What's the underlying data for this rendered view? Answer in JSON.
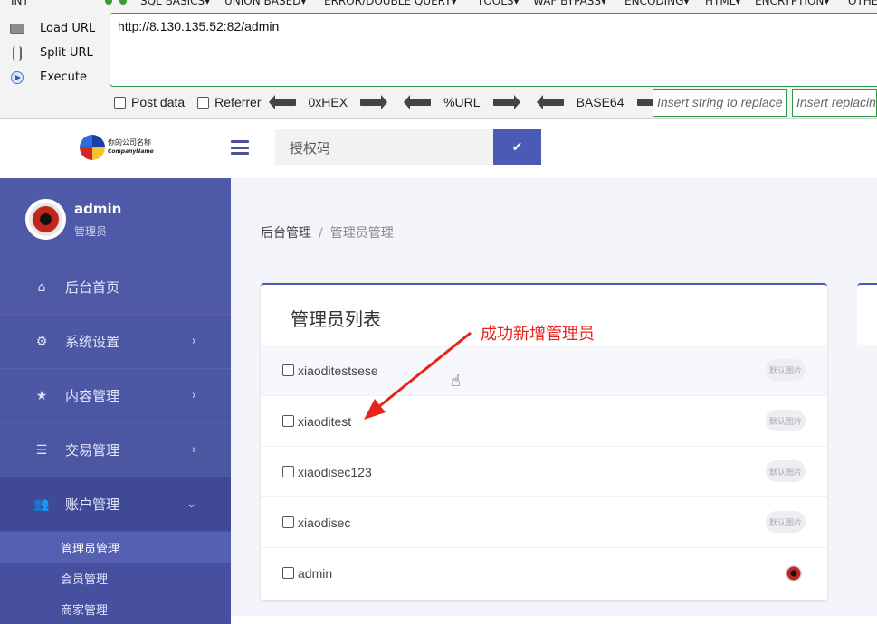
{
  "hackbar": {
    "menu": [
      "INT",
      "SQL BASICS▾",
      "UNION BASED▾",
      "ERROR/DOUBLE QUERY▾",
      "TOOLS▾",
      "WAF BYPASS▾",
      "ENCODING▾",
      "HTML▾",
      "ENCRYPTION▾",
      "OTHER"
    ],
    "actions": {
      "load": "Load URL",
      "split": "Split URL",
      "execute": "Execute"
    },
    "url": "http://8.130.135.52:82/admin",
    "options": {
      "post": "Post data",
      "referrer": "Referrer"
    },
    "encoders": [
      "0xHEX",
      "%URL",
      "BASE64"
    ],
    "replace_placeholder": "Insert string to replace",
    "replacing_placeholder": "Insert replacing string"
  },
  "topbar": {
    "logo_line1": "你的公司名称",
    "logo_line2": "CompanyName",
    "authcode_placeholder": "授权码",
    "confirm_icon": "check-icon"
  },
  "sidebar": {
    "user": {
      "name": "admin",
      "role": "管理员"
    },
    "items": [
      {
        "label": "后台首页",
        "icon": "home-icon"
      },
      {
        "label": "系统设置",
        "icon": "gear-icon"
      },
      {
        "label": "内容管理",
        "icon": "star-icon"
      },
      {
        "label": "交易管理",
        "icon": "list-icon"
      },
      {
        "label": "账户管理",
        "icon": "users-icon"
      }
    ],
    "sub_items": [
      "管理员管理",
      "会员管理",
      "商家管理"
    ]
  },
  "main": {
    "breadcrumb": {
      "root": "后台管理",
      "current": "管理员管理"
    },
    "card_title": "管理员列表",
    "rows": [
      {
        "name": "xiaoditestsese",
        "tag": "默认图片"
      },
      {
        "name": "xiaoditest",
        "tag": "默认图片"
      },
      {
        "name": "xiaodisec123",
        "tag": "默认图片"
      },
      {
        "name": "xiaodisec",
        "tag": "默认图片"
      },
      {
        "name": "admin",
        "tag": ""
      }
    ]
  },
  "annotation": {
    "text": "成功新增管理员",
    "color": "#e5241a"
  },
  "colors": {
    "accent": "#4b5bb5",
    "sidebar": "#4f5aa8"
  }
}
